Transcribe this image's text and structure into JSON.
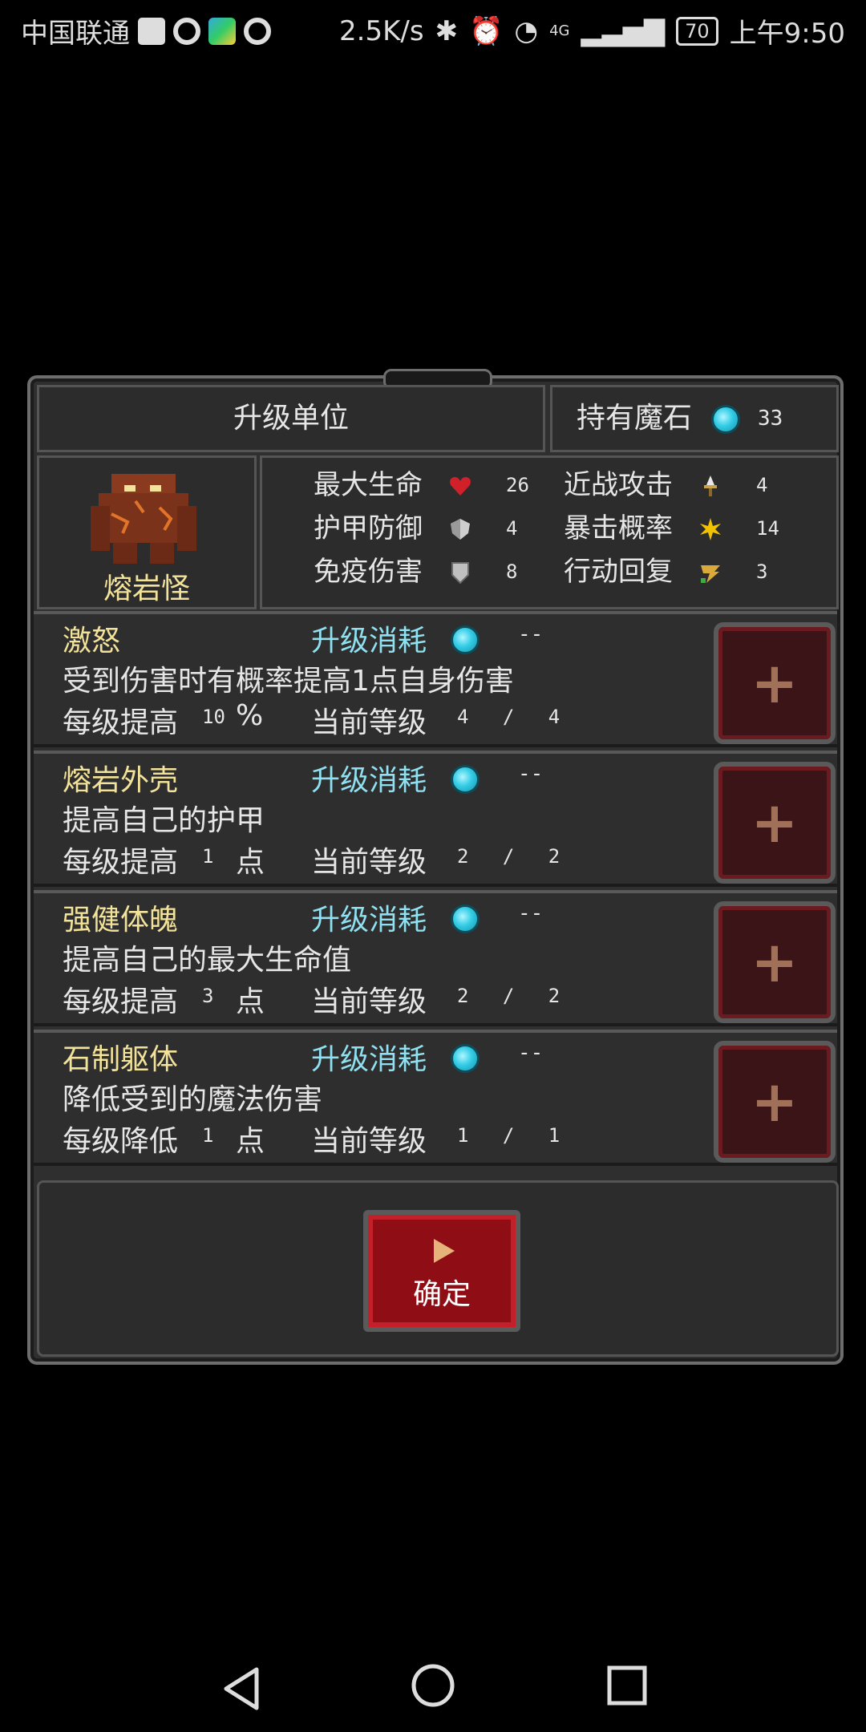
{
  "status_bar": {
    "carrier": "中国联通",
    "speed": "2.5K/s",
    "network": "4G",
    "battery": "70",
    "time": "上午9:50"
  },
  "header": {
    "title": "升级单位",
    "gem_label": "持有魔石",
    "gem_count": "33"
  },
  "monster": {
    "name": "熔岩怪"
  },
  "stats": [
    {
      "label": "最大生命",
      "icon": "heart-icon",
      "value": "26"
    },
    {
      "label": "近战攻击",
      "icon": "sword-icon",
      "value": "4"
    },
    {
      "label": "护甲防御",
      "icon": "armor-icon",
      "value": "4"
    },
    {
      "label": "暴击概率",
      "icon": "crit-icon",
      "value": "14"
    },
    {
      "label": "免疫伤害",
      "icon": "shield-icon",
      "value": "8"
    },
    {
      "label": "行动回复",
      "icon": "speed-icon",
      "value": "3"
    }
  ],
  "upgrades": [
    {
      "name": "激怒",
      "cost_label": "升级消耗",
      "cost": "--",
      "desc": "受到伤害时有概率提高1点自身伤害",
      "per_label": "每级提高",
      "per_value": "10",
      "per_unit": "%",
      "level_label": "当前等级",
      "level": "4 / 4"
    },
    {
      "name": "熔岩外壳",
      "cost_label": "升级消耗",
      "cost": "--",
      "desc": "提高自己的护甲",
      "per_label": "每级提高",
      "per_value": "1",
      "per_unit": "点",
      "level_label": "当前等级",
      "level": "2 / 2"
    },
    {
      "name": "强健体魄",
      "cost_label": "升级消耗",
      "cost": "--",
      "desc": "提高自己的最大生命值",
      "per_label": "每级提高",
      "per_value": "3",
      "per_unit": "点",
      "level_label": "当前等级",
      "level": "2 / 2"
    },
    {
      "name": "石制躯体",
      "cost_label": "升级消耗",
      "cost": "--",
      "desc": "降低受到的魔法伤害",
      "per_label": "每级降低",
      "per_value": "1",
      "per_unit": "点",
      "level_label": "当前等级",
      "level": "1 / 1"
    }
  ],
  "plus_label": "+",
  "confirm_label": "确定"
}
